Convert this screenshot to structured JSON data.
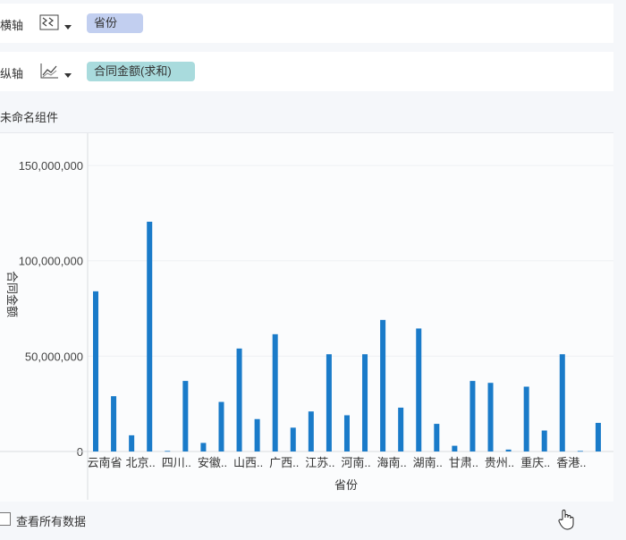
{
  "x_axis_row": {
    "label": "横轴",
    "field": "省份"
  },
  "y_axis_row": {
    "label": "纵轴",
    "field": "合同金额(求和)"
  },
  "component_title": "未命名组件",
  "show_all_data_label": "查看所有数据",
  "colors": {
    "bar": "#1a7bc9",
    "pill_x": "#c2cff0",
    "pill_y": "#a9dbdd"
  },
  "chart_data": {
    "type": "bar",
    "xlabel": "省份",
    "ylabel": "合同金额",
    "ylim": [
      0,
      150000000
    ],
    "yticks": [
      "0",
      "50,000,000",
      "100,000,000",
      "150,000,000"
    ],
    "tick_labels": [
      "云南省",
      "北京..",
      "四川..",
      "安徽..",
      "山西..",
      "广西..",
      "江苏..",
      "河南..",
      "海南..",
      "湖南..",
      "甘肃..",
      "贵州..",
      "重庆..",
      "香港.."
    ],
    "values": [
      84000000,
      29000000,
      8500000,
      120500000,
      300000,
      37000000,
      4500000,
      26000000,
      54000000,
      17000000,
      61500000,
      12500000,
      21000000,
      51000000,
      19000000,
      51000000,
      69000000,
      23000000,
      64500000,
      14500000,
      3000000,
      37000000,
      36000000,
      1000000,
      34000000,
      11000000,
      51000000,
      300000,
      15000000
    ]
  }
}
